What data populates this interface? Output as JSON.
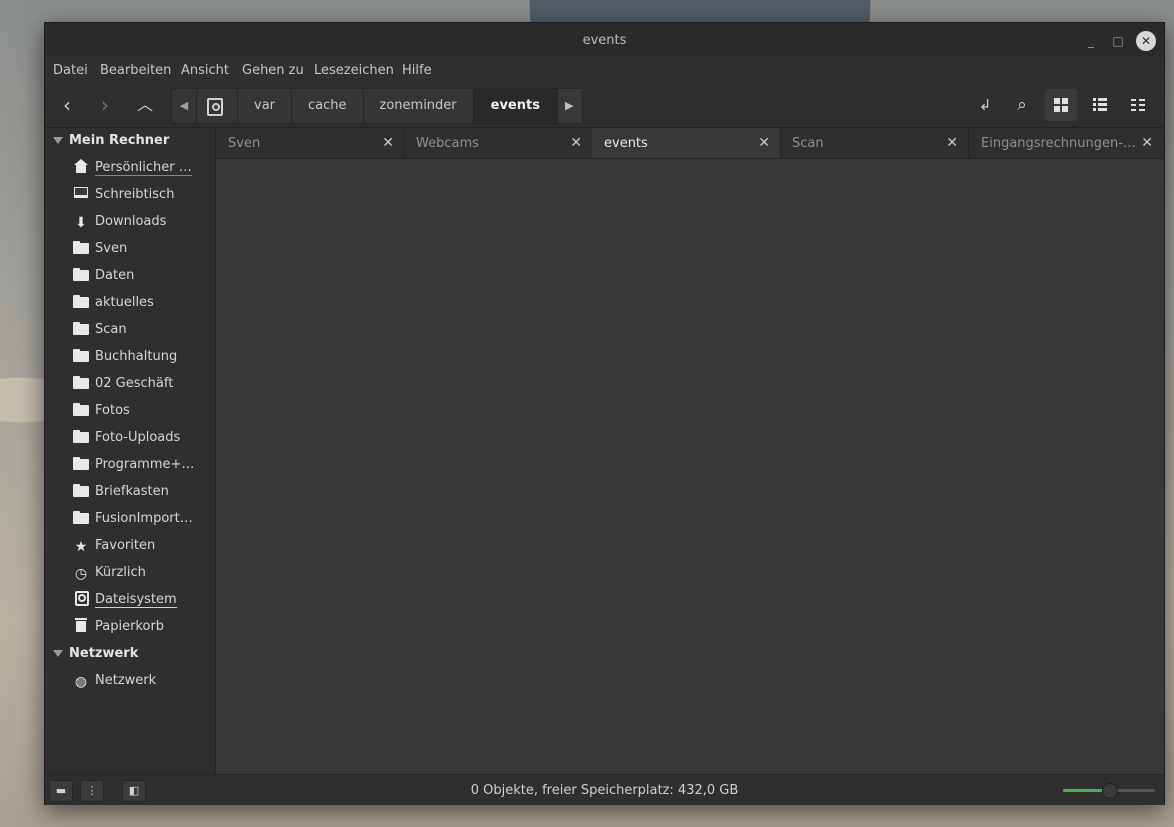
{
  "window": {
    "title": "events"
  },
  "menu": [
    "Datei",
    "Bearbeiten",
    "Ansicht",
    "Gehen zu",
    "Lesezeichen",
    "Hilfe"
  ],
  "breadcrumb": [
    "var",
    "cache",
    "zoneminder",
    "events"
  ],
  "sidebar": {
    "section1": "Mein Rechner",
    "items": [
      {
        "label": "Persönlicher …",
        "icon": "home-icon"
      },
      {
        "label": "Schreibtisch",
        "icon": "desktop-icon"
      },
      {
        "label": "Downloads",
        "icon": "download-icon"
      },
      {
        "label": "Sven",
        "icon": "folder-icon"
      },
      {
        "label": "Daten",
        "icon": "folder-icon"
      },
      {
        "label": "aktuelles",
        "icon": "folder-icon"
      },
      {
        "label": "Scan",
        "icon": "folder-icon"
      },
      {
        "label": "Buchhaltung",
        "icon": "folder-icon"
      },
      {
        "label": "02 Geschäft",
        "icon": "folder-icon"
      },
      {
        "label": "Fotos",
        "icon": "folder-icon"
      },
      {
        "label": "Foto-Uploads",
        "icon": "folder-icon"
      },
      {
        "label": "Programme+…",
        "icon": "folder-icon"
      },
      {
        "label": "Briefkasten",
        "icon": "folder-icon"
      },
      {
        "label": "FusionImport…",
        "icon": "folder-icon"
      },
      {
        "label": "Favoriten",
        "icon": "star-icon"
      },
      {
        "label": "Kürzlich",
        "icon": "clock-icon"
      },
      {
        "label": "Dateisystem",
        "icon": "drive-icon"
      },
      {
        "label": "Papierkorb",
        "icon": "trash-icon"
      }
    ],
    "section2": "Netzwerk",
    "network_items": [
      {
        "label": "Netzwerk",
        "icon": "globe-icon"
      }
    ]
  },
  "tabs": [
    {
      "label": "Sven",
      "active": false
    },
    {
      "label": "Webcams",
      "active": false
    },
    {
      "label": "events",
      "active": true
    },
    {
      "label": "Scan",
      "active": false
    },
    {
      "label": "Eingangsrechnungen-…",
      "active": false
    }
  ],
  "status": {
    "text": "0 Objekte, freier Speicherplatz: 432,0 GB",
    "zoom_fraction": 0.5
  },
  "colors": {
    "accent": "#4caf50",
    "window_bg": "#2f2f2f",
    "content_bg": "#383838"
  }
}
